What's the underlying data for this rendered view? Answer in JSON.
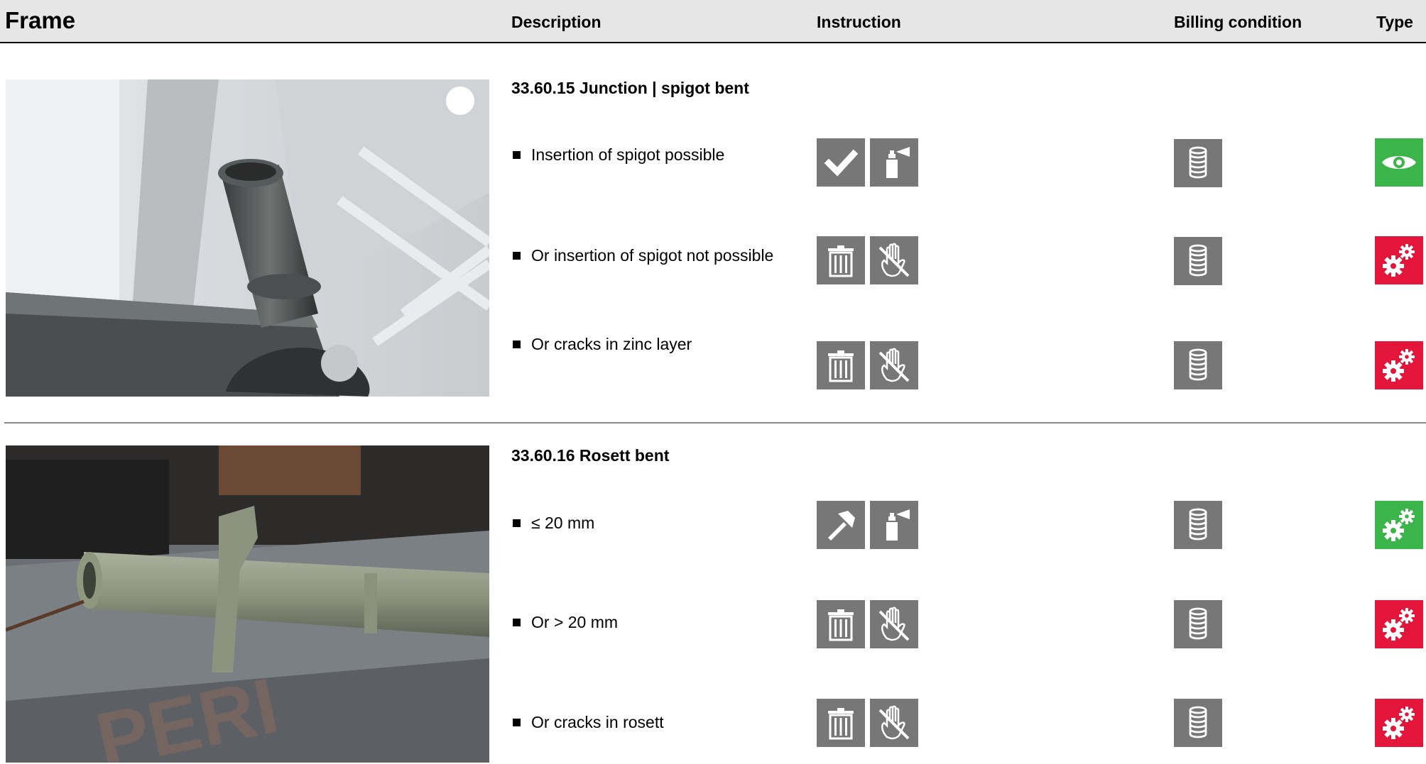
{
  "header": {
    "frame": "Frame",
    "description": "Description",
    "instruction": "Instruction",
    "billing": "Billing condition",
    "type": "Type"
  },
  "sections": [
    {
      "title": "33.60.15 Junction | spigot bent",
      "rows": [
        {
          "text": "Insertion of spigot possible",
          "instructions": [
            "check-icon",
            "spray-can-icon"
          ],
          "billing": "coin-stack-icon",
          "type": "eye-icon",
          "type_color": "#3bb44a"
        },
        {
          "text": "Or insertion of spigot not possible",
          "instructions": [
            "trash-icon",
            "no-touch-icon"
          ],
          "billing": "coin-stack-icon",
          "type": "gears-icon",
          "type_color": "#e3153a"
        },
        {
          "text": "Or cracks in zinc layer",
          "instructions": [
            "trash-icon",
            "no-touch-icon"
          ],
          "billing": "coin-stack-icon",
          "type": "gears-icon",
          "type_color": "#e3153a"
        }
      ]
    },
    {
      "title": "33.60.16 Rosett bent",
      "rows": [
        {
          "text": "≤ 20 mm",
          "instructions": [
            "hammer-icon",
            "spray-can-icon"
          ],
          "billing": "coin-stack-icon",
          "type": "gears-icon",
          "type_color": "#3bb44a"
        },
        {
          "text": "Or  > 20 mm",
          "instructions": [
            "trash-icon",
            "no-touch-icon"
          ],
          "billing": "coin-stack-icon",
          "type": "gears-icon",
          "type_color": "#e3153a"
        },
        {
          "text": "Or cracks in rosett",
          "instructions": [
            "trash-icon",
            "no-touch-icon"
          ],
          "billing": "coin-stack-icon",
          "type": "gears-icon",
          "type_color": "#e3153a"
        }
      ]
    }
  ]
}
